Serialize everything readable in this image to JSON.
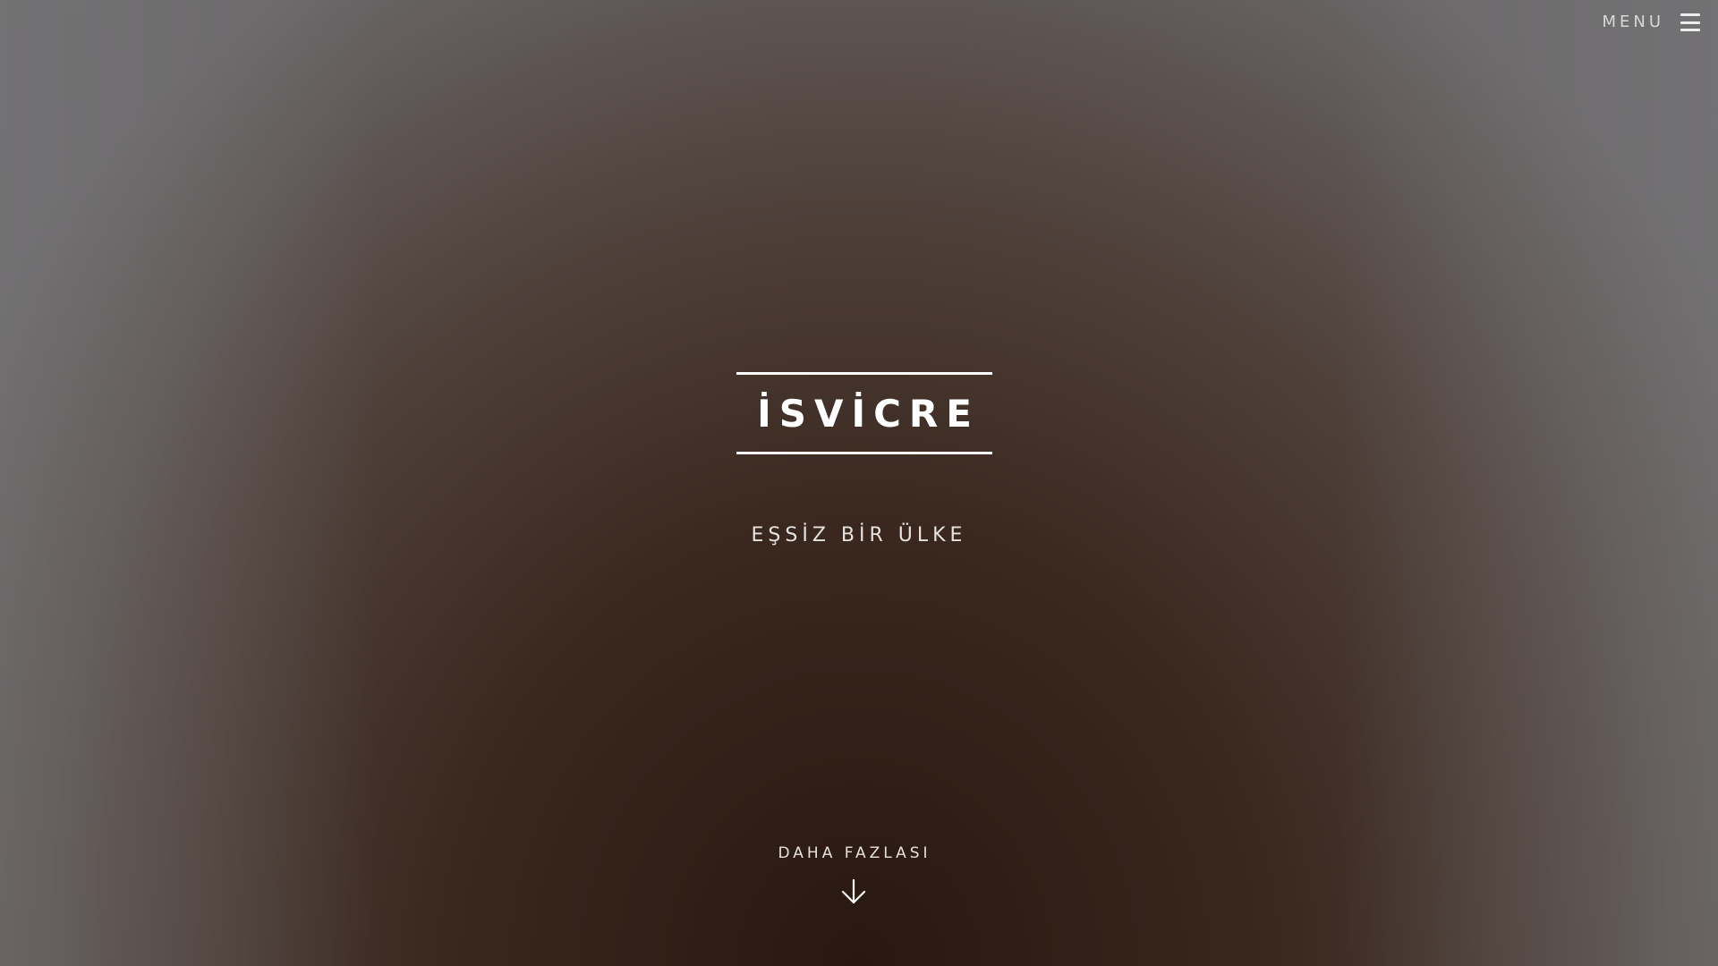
{
  "header": {
    "menu_label": "MENU",
    "menu_icon": "hamburger-icon"
  },
  "hero": {
    "title": "İSVİCRE",
    "subtitle": "EŞSİZ BİR ÜLKE",
    "more_label": "DAHA FAZLASI",
    "more_icon": "arrow-down-icon"
  },
  "colors": {
    "text": "#ffffff",
    "background_dark": "#2a1a12",
    "background_edge": "#6e6c6e"
  }
}
